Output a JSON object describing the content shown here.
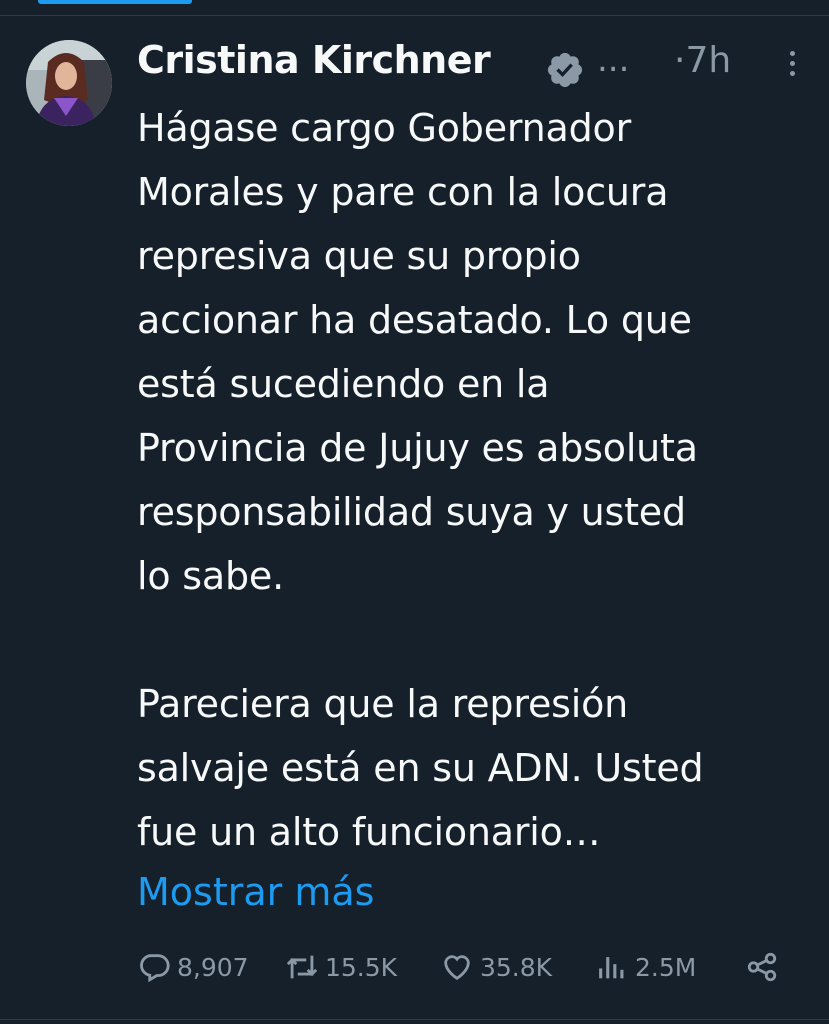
{
  "tweet": {
    "author_name": "Cristina Kirchner",
    "handle_truncated": "...",
    "separator": "·",
    "time": "7h",
    "text": "Hágase cargo Gobernador\nMorales y pare con la locura\nrepresiva que su propio\naccionar ha desatado. Lo que\nestá sucediendo en la\nProvincia de Jujuy es absoluta\nresponsabilidad suya y usted\nlo sabe.\n\nPareciera que la represión\nsalvaje está en su ADN. Usted\nfue un alto funcionario…",
    "show_more": "Mostrar más"
  },
  "actions": {
    "replies": "8,907",
    "retweets": "15.5K",
    "likes": "35.8K",
    "views": "2.5M"
  },
  "icons": {
    "verified": "verified-badge-icon",
    "more": "more-vertical-icon",
    "reply": "reply-icon",
    "retweet": "retweet-icon",
    "like": "heart-icon",
    "views": "views-chart-icon",
    "share": "share-icon"
  },
  "colors": {
    "background": "#15202b",
    "text": "#f7f9f9",
    "muted": "#8b98a5",
    "accent": "#1d9bf0"
  }
}
